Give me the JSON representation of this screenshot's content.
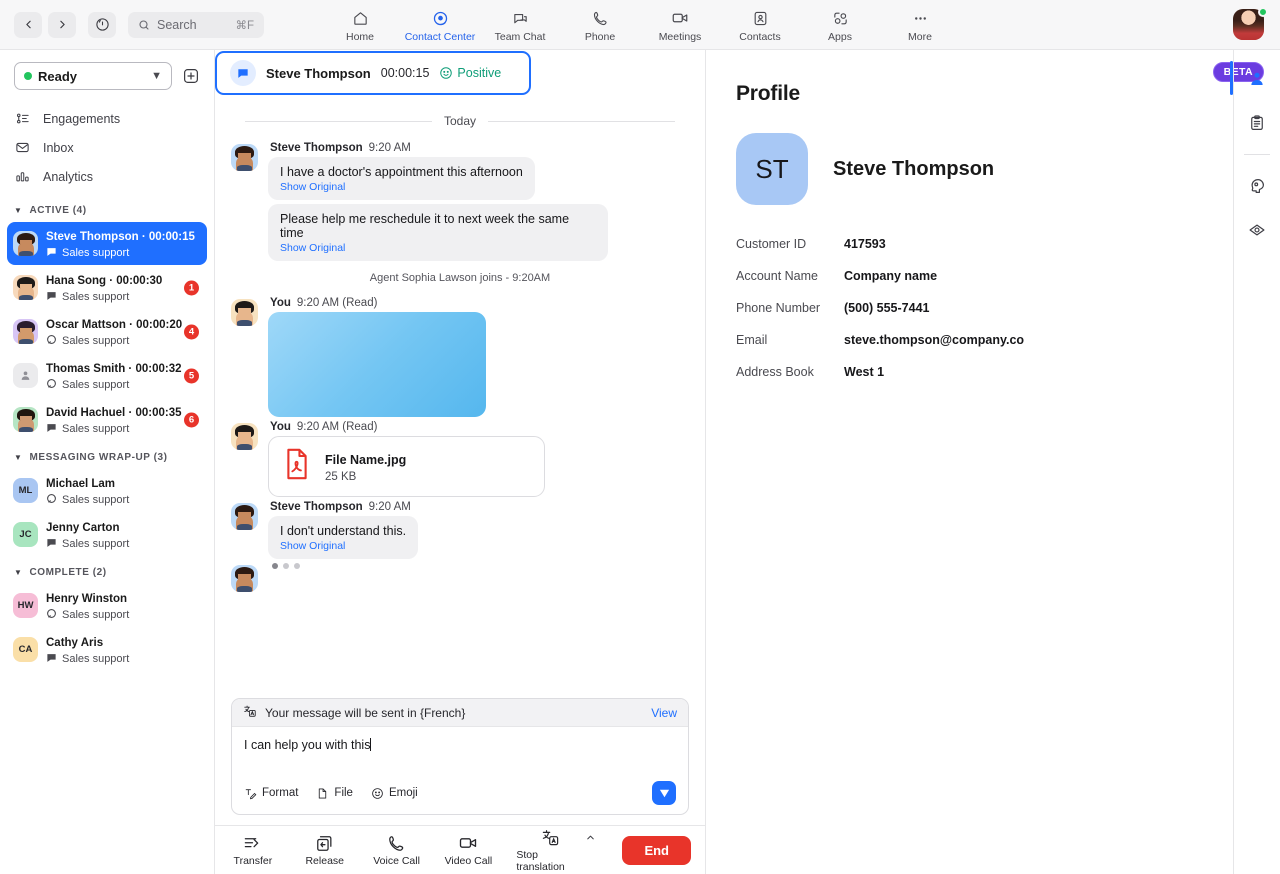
{
  "topbar": {
    "back_icon": "chevron-left-icon",
    "forward_icon": "chevron-right-icon",
    "history_icon": "history-clock-icon",
    "search_placeholder": "Search",
    "search_shortcut": "⌘F",
    "nav": [
      {
        "label": "Home",
        "icon": "home-icon",
        "active": false
      },
      {
        "label": "Contact Center",
        "icon": "contact-center-icon",
        "active": true
      },
      {
        "label": "Team Chat",
        "icon": "team-chat-icon",
        "active": false
      },
      {
        "label": "Phone",
        "icon": "phone-icon",
        "active": false
      },
      {
        "label": "Meetings",
        "icon": "video-camera-icon",
        "active": false
      },
      {
        "label": "Contacts",
        "icon": "contacts-icon",
        "active": false
      },
      {
        "label": "Apps",
        "icon": "apps-icon",
        "active": false
      },
      {
        "label": "More",
        "icon": "more-ellipsis-icon",
        "active": false
      }
    ],
    "presence_status": "online"
  },
  "sidebar": {
    "status_value": "Ready",
    "status_color": "#22c55e",
    "add_button_icon": "plus-square-icon",
    "nav_items": [
      {
        "label": "Engagements",
        "icon": "engagements-icon"
      },
      {
        "label": "Inbox",
        "icon": "inbox-envelope-icon"
      },
      {
        "label": "Analytics",
        "icon": "analytics-bars-icon"
      }
    ],
    "groups": [
      {
        "title": "ACTIVE (4)",
        "items": [
          {
            "name": "Steve Thompson",
            "timer": "00:00:15",
            "queue": "Sales support",
            "badge": "",
            "selected": true,
            "avatar_type": "photo",
            "avatar_tint": "#bcd9f7",
            "channel_icon": "chat-filled-icon"
          },
          {
            "name": "Hana Song",
            "timer": "00:00:30",
            "queue": "Sales support",
            "badge": "1",
            "selected": false,
            "avatar_type": "photo",
            "avatar_tint": "#f7d9bc",
            "channel_icon": "chat-filled-icon"
          },
          {
            "name": "Oscar Mattson",
            "timer": "00:00:20",
            "queue": "Sales support",
            "badge": "4",
            "selected": false,
            "avatar_type": "photo",
            "avatar_tint": "#d7c5f5",
            "channel_icon": "chat-outline-icon"
          },
          {
            "name": "Thomas Smith",
            "timer": "00:00:32",
            "queue": "Sales support",
            "badge": "5",
            "selected": false,
            "avatar_type": "placeholder",
            "avatar_tint": "#ebebed",
            "channel_icon": "chat-outline-icon"
          },
          {
            "name": "David Hachuel",
            "timer": "00:00:35",
            "queue": "Sales support",
            "badge": "6",
            "selected": false,
            "avatar_type": "photo",
            "avatar_tint": "#b6e5c4",
            "channel_icon": "chat-filled-icon"
          }
        ]
      },
      {
        "title": "MESSAGING WRAP-UP (3)",
        "items": [
          {
            "name": "Michael Lam",
            "timer": "",
            "queue": "Sales support",
            "badge": "",
            "selected": false,
            "avatar_type": "initials",
            "initials": "ML",
            "avatar_tint": "#a9c6f2",
            "channel_icon": "chat-outline-icon"
          },
          {
            "name": "Jenny Carton",
            "timer": "",
            "queue": "Sales support",
            "badge": "",
            "selected": false,
            "avatar_type": "initials",
            "initials": "JC",
            "avatar_tint": "#a8e5bf",
            "channel_icon": "chat-filled-icon"
          }
        ]
      },
      {
        "title": "COMPLETE (2)",
        "items": [
          {
            "name": "Henry Winston",
            "timer": "",
            "queue": "Sales support",
            "badge": "",
            "selected": false,
            "avatar_type": "initials",
            "initials": "HW",
            "avatar_tint": "#f6bdd6",
            "channel_icon": "chat-outline-icon"
          },
          {
            "name": "Cathy Aris",
            "timer": "",
            "queue": "Sales support",
            "badge": "",
            "selected": false,
            "avatar_type": "initials",
            "initials": "CA",
            "avatar_tint": "#fadfa8",
            "channel_icon": "chat-filled-icon"
          }
        ]
      }
    ]
  },
  "conversation": {
    "tab": {
      "channel_icon": "chat-bubble-icon",
      "name": "Steve Thompson",
      "timer": "00:00:15",
      "sentiment": "Positive",
      "sentiment_icon": "smiley-face-icon",
      "sentiment_color": "#0f9d78"
    },
    "beta_badge": "BETA",
    "day_divider": "Today",
    "system_line": "Agent Sophia Lawson joins - 9:20AM",
    "messages": [
      {
        "kind": "text",
        "sender": "Steve Thompson",
        "time": "9:20 AM",
        "side": "in",
        "show_avatar": true,
        "text": "I have a doctor's appointment this afternoon",
        "show_original": "Show Original"
      },
      {
        "kind": "text",
        "sender": "",
        "time": "",
        "side": "in",
        "show_avatar": false,
        "text": "Please help me reschedule it to next week the same time",
        "show_original": "Show Original"
      },
      {
        "kind": "image",
        "sender": "You",
        "time": "9:20 AM",
        "read_state": "(Read)",
        "side": "out",
        "show_avatar": true
      },
      {
        "kind": "file",
        "sender": "You",
        "time": "9:20 AM",
        "read_state": "(Read)",
        "side": "out",
        "show_avatar": true,
        "file_name": "File Name.jpg",
        "file_size": "25 KB",
        "file_icon": "pdf-file-icon"
      },
      {
        "kind": "text",
        "sender": "Steve Thompson",
        "time": "9:20 AM",
        "side": "in",
        "show_avatar": true,
        "text": "I don't understand this.",
        "show_original": "Show Original"
      },
      {
        "kind": "typing",
        "side": "in",
        "show_avatar": true
      }
    ],
    "composer": {
      "translation_icon": "translate-icon",
      "translation_notice": "Your message will be sent in {French}",
      "view_label": "View",
      "draft_text": "I can help you with this",
      "tools": [
        {
          "label": "Format",
          "icon": "format-text-icon"
        },
        {
          "label": "File",
          "icon": "file-attach-icon"
        },
        {
          "label": "Emoji",
          "icon": "emoji-smiley-icon"
        }
      ],
      "send_icon": "send-paper-plane-icon"
    },
    "actions": [
      {
        "label": "Transfer",
        "icon": "transfer-icon"
      },
      {
        "label": "Release",
        "icon": "release-icon"
      },
      {
        "label": "Voice Call",
        "icon": "phone-handset-icon"
      },
      {
        "label": "Video Call",
        "icon": "video-camera-icon"
      },
      {
        "label": "Stop translation",
        "icon": "translate-stop-icon"
      }
    ],
    "end_button": "End"
  },
  "profile": {
    "title": "Profile",
    "avatar_initials": "ST",
    "name": "Steve Thompson",
    "fields": [
      {
        "key": "Customer ID",
        "value": "417593"
      },
      {
        "key": "Account Name",
        "value": "Company name"
      },
      {
        "key": "Phone Number",
        "value": "(500) 555-7441"
      },
      {
        "key": "Email",
        "value": "steve.thompson@company.co"
      },
      {
        "key": "Address Book",
        "value": "West 1"
      }
    ]
  },
  "right_rail": [
    {
      "icon": "profile-person-icon",
      "active": true
    },
    {
      "icon": "clipboard-notes-icon",
      "active": false
    },
    {
      "icon": "ai-assist-head-icon",
      "active": false
    },
    {
      "icon": "eye-insights-icon",
      "active": false
    }
  ]
}
